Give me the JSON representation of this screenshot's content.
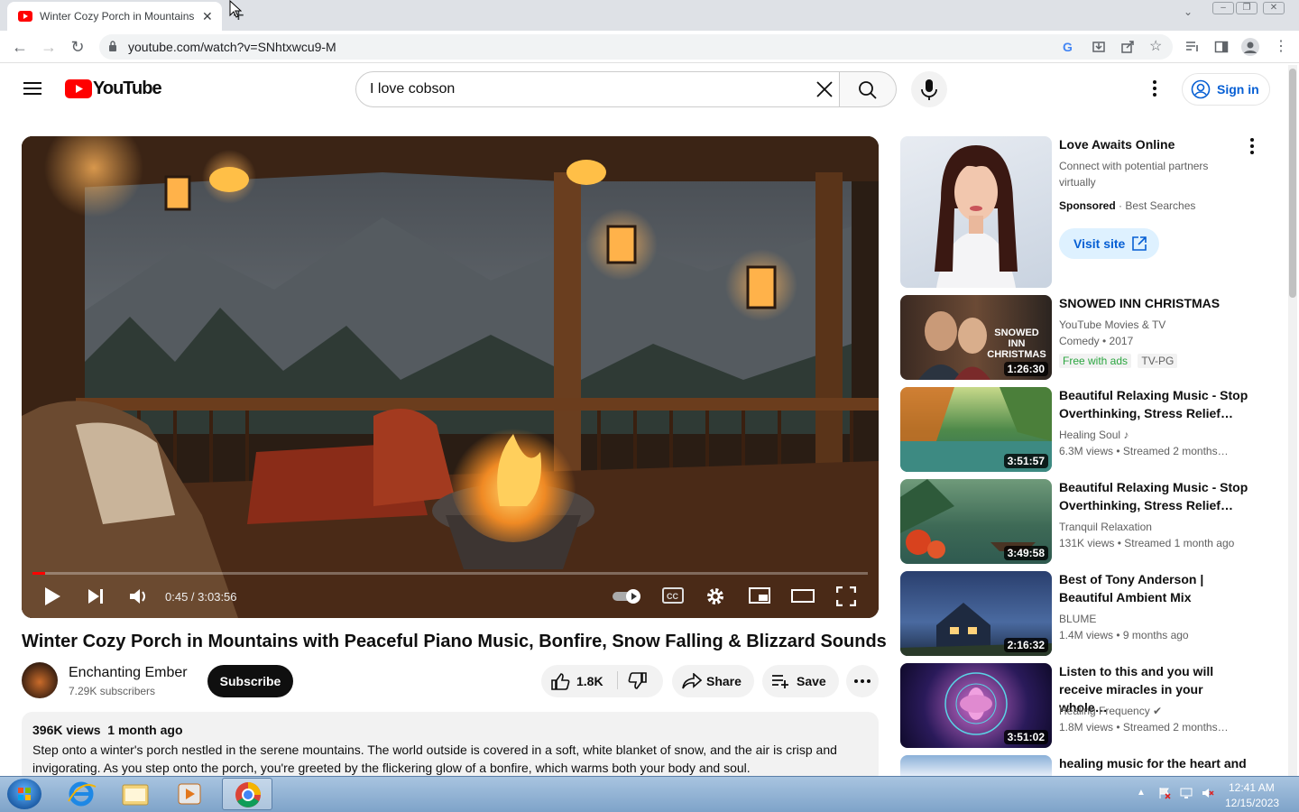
{
  "browser": {
    "tab_title": "Winter Cozy Porch in Mountains",
    "url": "youtube.com/watch?v=SNhtxwcu9-M"
  },
  "header": {
    "logo_text": "YouTube",
    "search_value": "I love cobson",
    "signin_label": "Sign in"
  },
  "player": {
    "time": "0:45 / 3:03:56",
    "progress_fraction": 0.004
  },
  "video": {
    "title": "Winter Cozy Porch in Mountains with Peaceful Piano Music, Bonfire, Snow Falling & Blizzard Sounds",
    "channel_name": "Enchanting Ember",
    "subscribers": "7.29K subscribers",
    "subscribe_label": "Subscribe",
    "likes": "1.8K",
    "share_label": "Share",
    "save_label": "Save",
    "views_and_date": "396K views  1 month ago",
    "description": "Step onto a winter's porch nestled in the serene mountains. The world outside is covered in a soft, white blanket of snow, and the air is crisp and invigorating. As you step onto the porch, you're greeted by the flickering glow of a bonfire, which warms both your body and soul."
  },
  "ad": {
    "title": "Love Awaits Online",
    "desc": "Connect with potential partners virtually",
    "sponsored": "Sponsored",
    "advertiser": "· Best Searches",
    "cta": "Visit site"
  },
  "related": [
    {
      "title": "SNOWED INN CHRISTMAS",
      "channel": "YouTube Movies & TV",
      "meta": "Comedy • 2017",
      "badge1": "Free with ads",
      "badge2": "TV-PG",
      "duration": "1:26:30",
      "thumb_text": "SNOWED INN CHRISTMAS"
    },
    {
      "title": "Beautiful Relaxing Music - Stop Overthinking, Stress Relief…",
      "channel": "Healing Soul ♪",
      "meta": "6.3M views  • Streamed 2 months…",
      "duration": "3:51:57"
    },
    {
      "title": "Beautiful Relaxing Music - Stop Overthinking, Stress Relief…",
      "channel": "Tranquil Relaxation",
      "meta": "131K views  • Streamed 1 month ago",
      "duration": "3:49:58"
    },
    {
      "title": "Best of Tony Anderson | Beautiful Ambient Mix",
      "channel": "BLUME",
      "meta": "1.4M views  • 9 months ago",
      "duration": "2:16:32"
    },
    {
      "title": "Listen to this and you will receive miracles in your whole…",
      "channel": "Healing Frequency ✔",
      "meta": "1.8M views  • Streamed 2 months…",
      "duration": "3:51:02"
    },
    {
      "title": "healing music for the heart and",
      "channel": "",
      "meta": "",
      "duration": ""
    }
  ],
  "taskbar": {
    "time": "12:41 AM",
    "date": "12/15/2023"
  },
  "colors": {
    "brand_red": "#ff0000",
    "link_blue": "#065fd4",
    "free_green": "#2ba640"
  }
}
